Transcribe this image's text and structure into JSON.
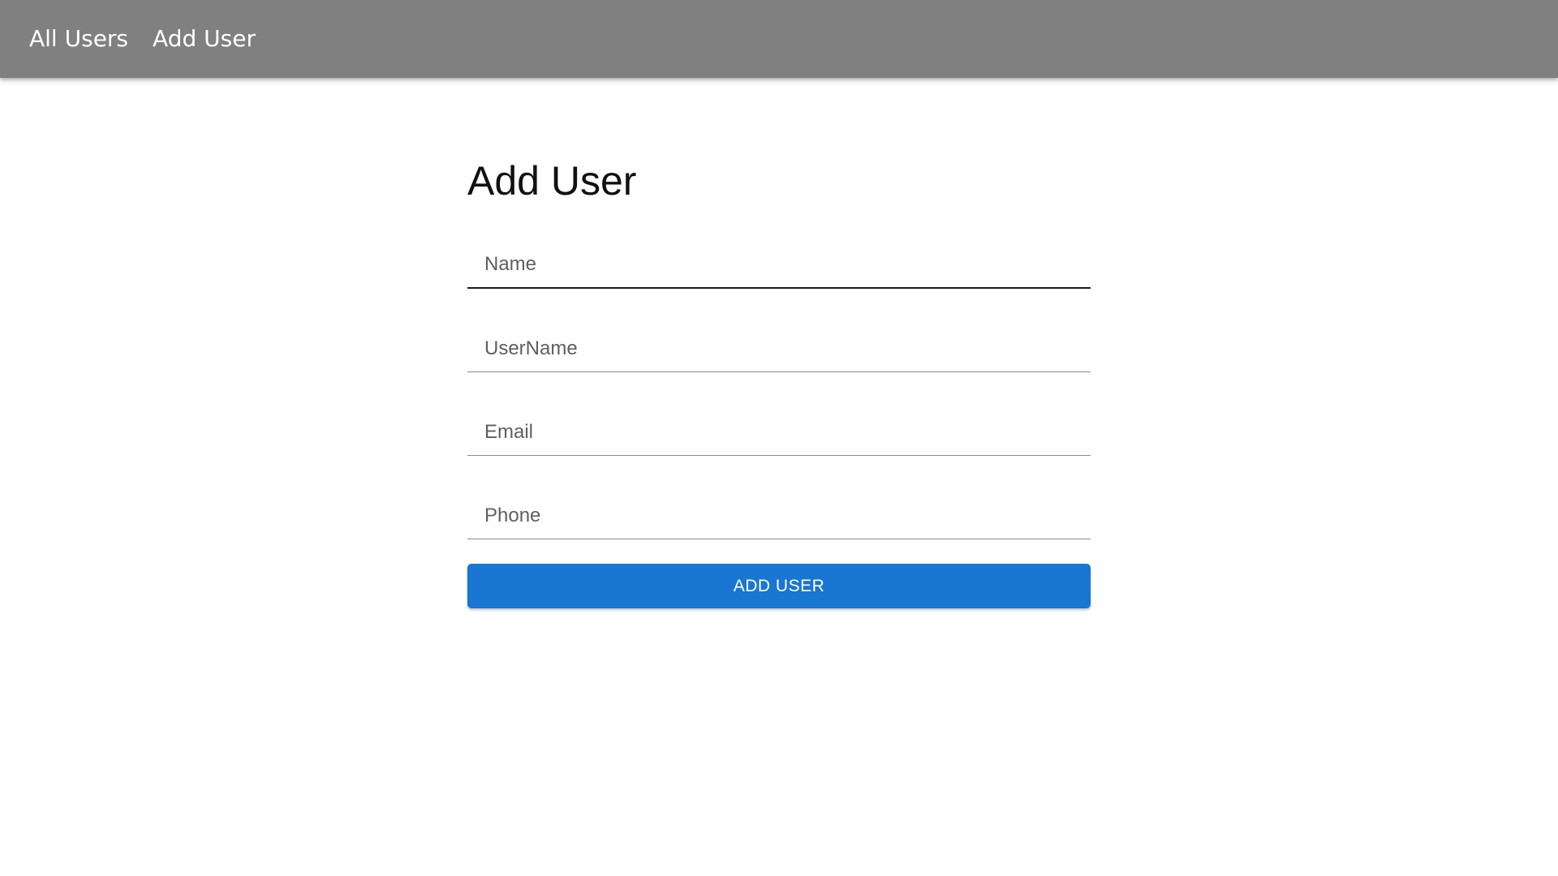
{
  "nav": {
    "links": [
      {
        "label": "All Users"
      },
      {
        "label": "Add User"
      }
    ]
  },
  "form": {
    "title": "Add User",
    "fields": [
      {
        "placeholder": "Name",
        "value": ""
      },
      {
        "placeholder": "UserName",
        "value": ""
      },
      {
        "placeholder": "Email",
        "value": ""
      },
      {
        "placeholder": "Phone",
        "value": ""
      }
    ],
    "submit_label": "ADD USER"
  },
  "colors": {
    "navbar": "#808080",
    "button": "#1976d2"
  }
}
